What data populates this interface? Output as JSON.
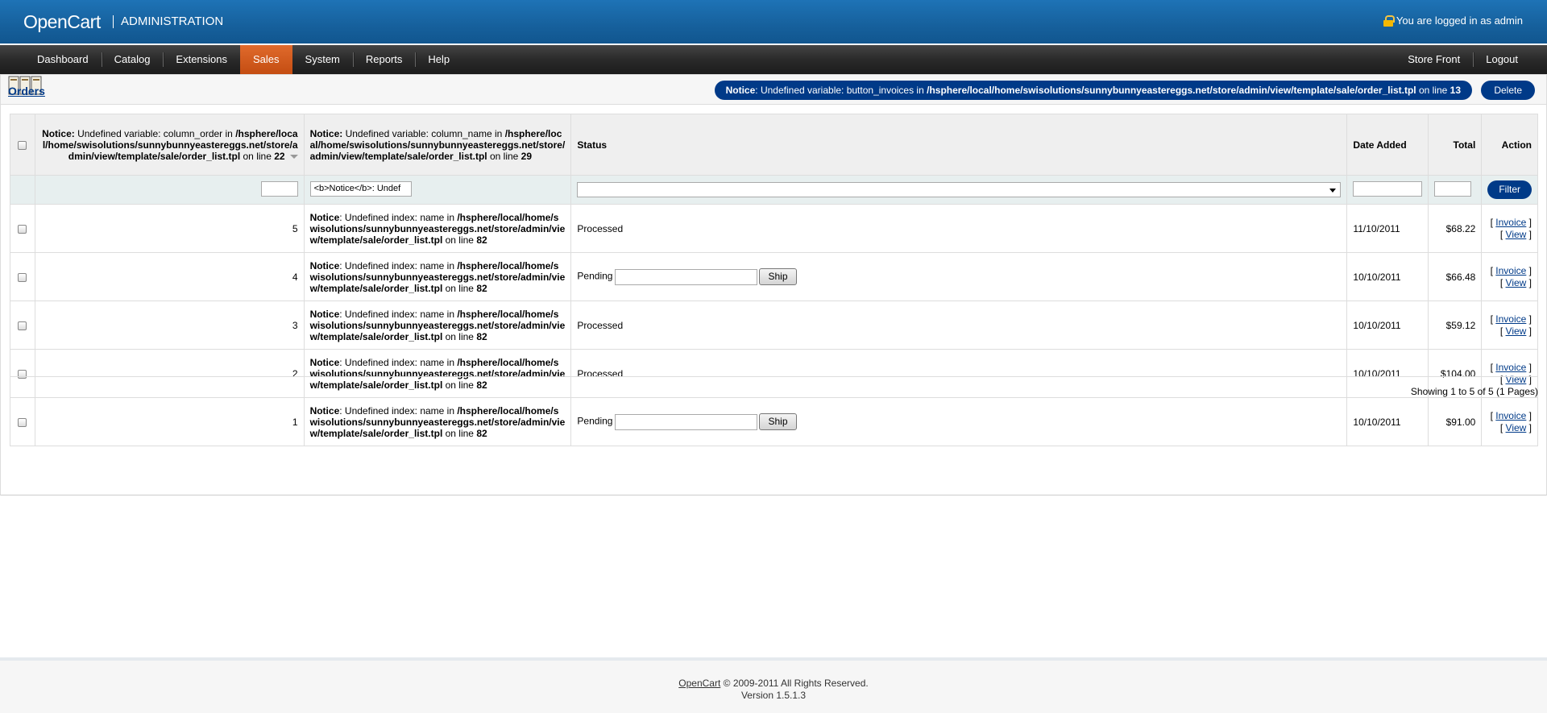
{
  "header": {
    "brand": "OpenCart",
    "subtitle": "ADMINISTRATION",
    "logged_in": "You are logged in as admin"
  },
  "menu": {
    "left": [
      "Dashboard",
      "Catalog",
      "Extensions",
      "Sales",
      "System",
      "Reports",
      "Help"
    ],
    "active": "Sales",
    "right": [
      "Store Front",
      "Logout"
    ]
  },
  "page": {
    "title": "Orders",
    "notice_button": {
      "prefix": "Notice",
      "text": ": Undefined variable: button_invoices in ",
      "path": "/hsphere/local/home/swisolutions/sunnybunnyeastereggs.net/store/admin/view/template/sale/order_list.tpl",
      "on_line": " on line ",
      "line": "13"
    },
    "delete_label": "Delete"
  },
  "table": {
    "col_order": {
      "prefix": "Notice:",
      "text": " Undefined variable: column_order in ",
      "path": "/hsphere/local/home/swisolutions/sunnybunnyeastereggs.net/store/admin/view/template/sale/order_list.tpl",
      "on_line": " on line ",
      "line": "22"
    },
    "col_name": {
      "prefix": "Notice:",
      "text": " Undefined variable: column_name in ",
      "path": "/hsphere/local/home/swisolutions/sunnybunnyeastereggs.net/store/admin/view/template/sale/order_list.tpl",
      "on_line": " on line ",
      "line": "29"
    },
    "col_status": "Status",
    "col_date": "Date Added",
    "col_total": "Total",
    "col_action": "Action",
    "filter": {
      "order_id_value": "",
      "name_value": "<b>Notice</b>: Undef",
      "status_value": "",
      "date_value": "",
      "total_value": "",
      "button": "Filter"
    },
    "row_notice": {
      "prefix": "Notice",
      "text": ": Undefined index: name in ",
      "path": "/hsphere/local/home/swisolutions/sunnybunnyeastereggs.net/store/admin/view/template/sale/order_list.tpl",
      "on_line": " on line ",
      "line": "82"
    },
    "rows": [
      {
        "id": "5",
        "status": "Processed",
        "ship": false,
        "date": "11/10/2011",
        "total": "$68.22"
      },
      {
        "id": "4",
        "status": "Pending",
        "ship": true,
        "date": "10/10/2011",
        "total": "$66.48"
      },
      {
        "id": "3",
        "status": "Processed",
        "ship": false,
        "date": "10/10/2011",
        "total": "$59.12"
      },
      {
        "id": "2",
        "status": "Processed",
        "ship": false,
        "date": "10/10/2011",
        "total": "$104.00"
      },
      {
        "id": "1",
        "status": "Pending",
        "ship": true,
        "date": "10/10/2011",
        "total": "$91.00"
      }
    ],
    "ship_label": "Ship",
    "invoice_label": "Invoice",
    "view_label": "View"
  },
  "pagination": "Showing 1 to 5 of 5 (1 Pages)",
  "footer": {
    "link": "OpenCart",
    "copyright": " © 2009-2011 All Rights Reserved.",
    "version": "Version 1.5.1.3"
  }
}
